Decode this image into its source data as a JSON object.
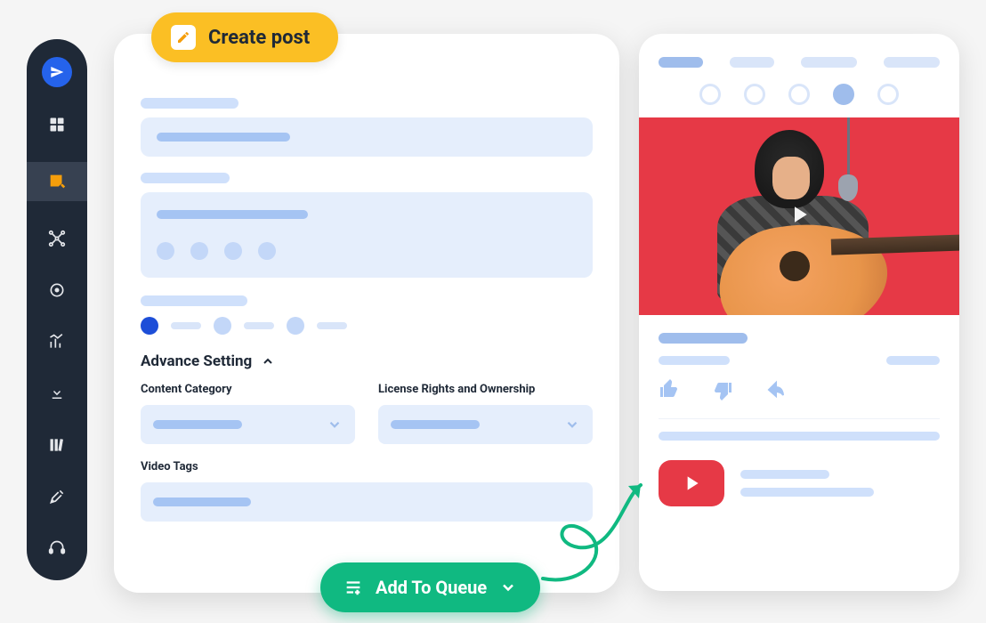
{
  "sidebar": {
    "items": [
      {
        "name": "logo-icon"
      },
      {
        "name": "dashboard-icon"
      },
      {
        "name": "compose-icon",
        "active": true
      },
      {
        "name": "network-icon"
      },
      {
        "name": "target-icon"
      },
      {
        "name": "analytics-icon"
      },
      {
        "name": "download-icon"
      },
      {
        "name": "library-icon"
      },
      {
        "name": "tools-icon"
      },
      {
        "name": "support-icon"
      }
    ]
  },
  "create_post": {
    "label": "Create post"
  },
  "advance": {
    "heading": "Advance Setting",
    "content_category_label": "Content Category",
    "license_label": "License Rights and Ownership",
    "video_tags_label": "Video Tags"
  },
  "queue": {
    "label": "Add To Queue"
  },
  "colors": {
    "accent_yellow": "#fbbf24",
    "accent_green": "#10b981",
    "accent_blue": "#2563eb",
    "accent_red": "#e63946"
  },
  "preview": {
    "platform": "youtube"
  }
}
